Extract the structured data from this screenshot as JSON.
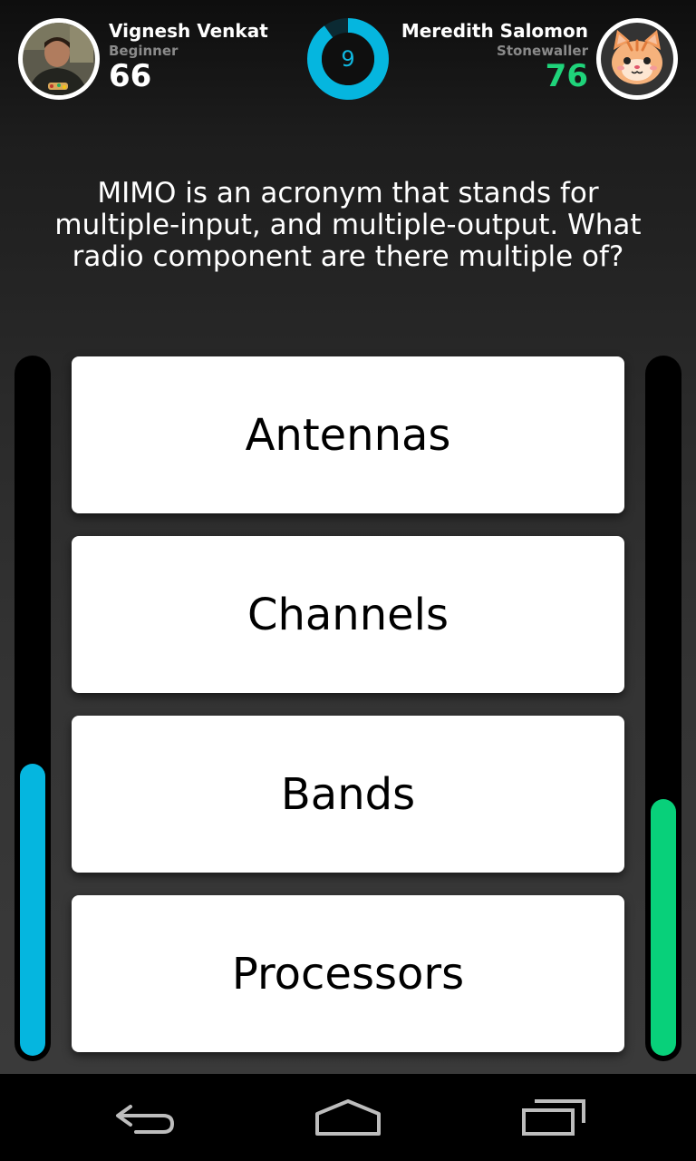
{
  "header": {
    "player_left": {
      "name": "Vignesh Venkat",
      "rank": "Beginner",
      "score": "66"
    },
    "player_right": {
      "name": "Meredith Salomon",
      "rank": "Stonewaller",
      "score": "76"
    },
    "timer": {
      "value": "9",
      "remaining_fraction": 0.9
    }
  },
  "question": {
    "text": "MIMO is an acronym that stands for multiple-input, and multiple-output. What radio component are there multiple of?"
  },
  "answers": [
    {
      "label": "Antennas"
    },
    {
      "label": "Channels"
    },
    {
      "label": "Bands"
    },
    {
      "label": "Processors"
    }
  ],
  "progress": {
    "left_fraction": 0.42,
    "right_fraction": 0.37
  },
  "navbar": {
    "items": [
      "back-icon",
      "home-icon",
      "recent-apps-icon"
    ]
  },
  "colors": {
    "accent_blue": "#05b6df",
    "accent_green": "#08d07a",
    "score_right": "#1fd37a"
  }
}
